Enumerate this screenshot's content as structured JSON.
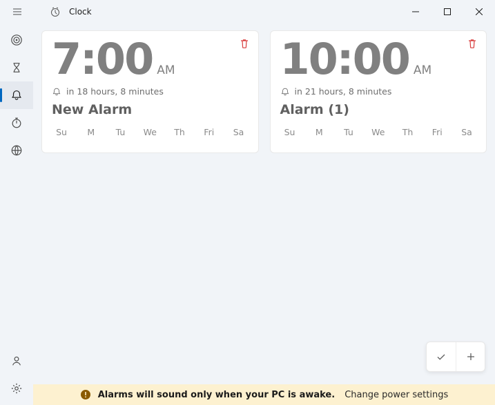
{
  "app": {
    "title": "Clock"
  },
  "alarms": [
    {
      "time": "7:00",
      "ampm": "AM",
      "in": "in 18 hours, 8 minutes",
      "name": "New Alarm",
      "days": [
        "Su",
        "M",
        "Tu",
        "We",
        "Th",
        "Fri",
        "Sa"
      ]
    },
    {
      "time": "10:00",
      "ampm": "AM",
      "in": "in 21 hours, 8 minutes",
      "name": "Alarm (1)",
      "days": [
        "Su",
        "M",
        "Tu",
        "We",
        "Th",
        "Fri",
        "Sa"
      ]
    }
  ],
  "alert": {
    "message": "Alarms will sound only when your PC is awake.",
    "link": "Change power settings"
  }
}
